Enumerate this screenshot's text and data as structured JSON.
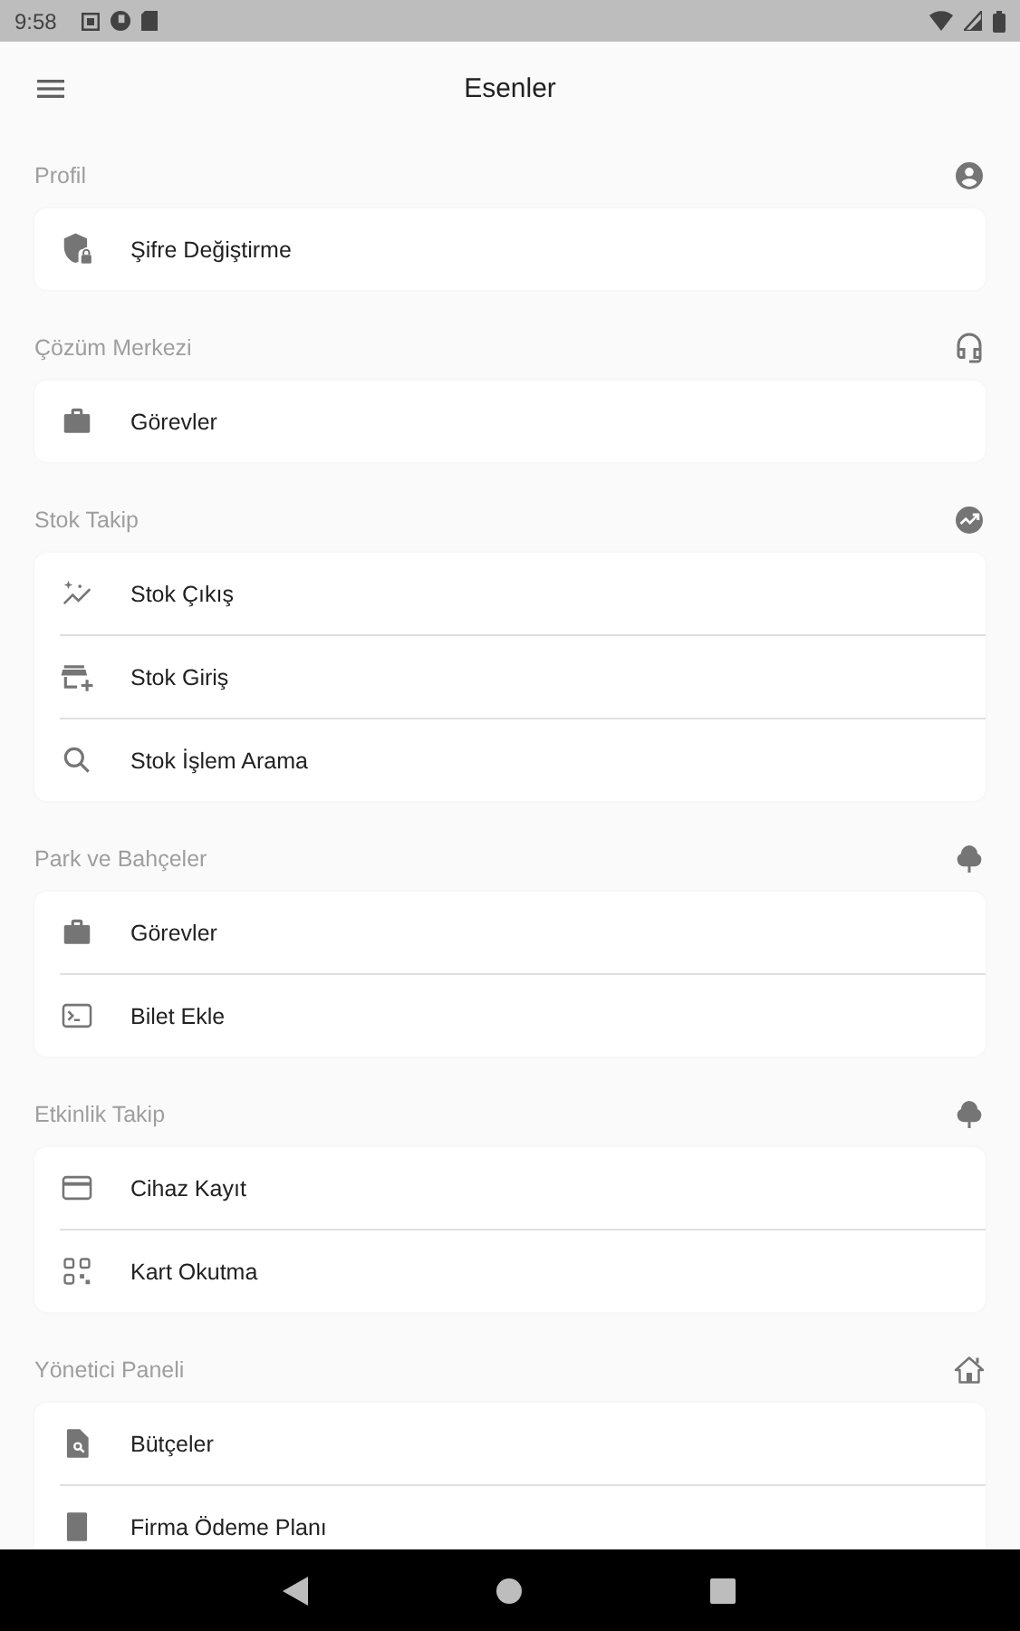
{
  "status_bar": {
    "time": "9:58"
  },
  "app_bar": {
    "title": "Esenler"
  },
  "sections": [
    {
      "title": "Profil",
      "items": [
        {
          "label": "Şifre Değiştirme"
        }
      ]
    },
    {
      "title": "Çözüm Merkezi",
      "items": [
        {
          "label": "Görevler"
        }
      ]
    },
    {
      "title": "Stok Takip",
      "items": [
        {
          "label": "Stok Çıkış"
        },
        {
          "label": "Stok Giriş"
        },
        {
          "label": "Stok İşlem Arama"
        }
      ]
    },
    {
      "title": "Park ve Bahçeler",
      "items": [
        {
          "label": "Görevler"
        },
        {
          "label": "Bilet Ekle"
        }
      ]
    },
    {
      "title": "Etkinlik Takip",
      "items": [
        {
          "label": "Cihaz Kayıt"
        },
        {
          "label": "Kart Okutma"
        }
      ]
    },
    {
      "title": "Yönetici Paneli",
      "items": [
        {
          "label": "Bütçeler"
        },
        {
          "label": "Firma Ödeme Planı"
        }
      ]
    }
  ]
}
